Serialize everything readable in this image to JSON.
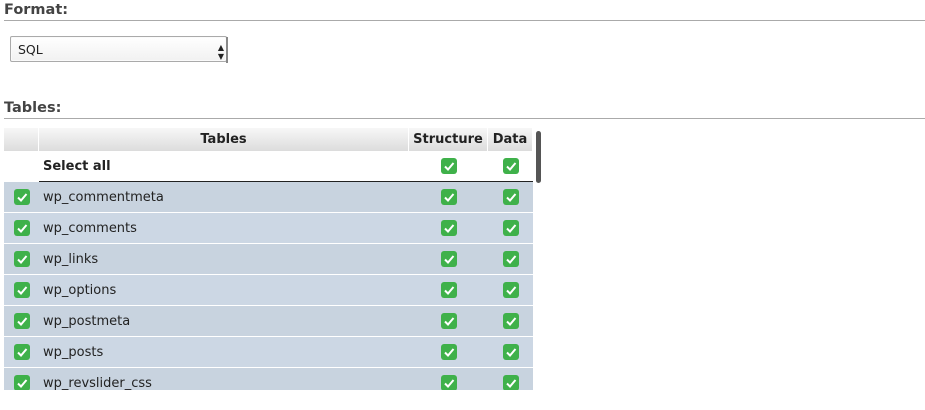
{
  "format": {
    "heading": "Format:",
    "selected": "SQL"
  },
  "tables": {
    "heading": "Tables:",
    "columns": {
      "tables": "Tables",
      "structure": "Structure",
      "data": "Data"
    },
    "select_all_label": "Select all",
    "rows": [
      {
        "name": "wp_commentmeta",
        "checked": true,
        "structure": true,
        "data": true
      },
      {
        "name": "wp_comments",
        "checked": true,
        "structure": true,
        "data": true
      },
      {
        "name": "wp_links",
        "checked": true,
        "structure": true,
        "data": true
      },
      {
        "name": "wp_options",
        "checked": true,
        "structure": true,
        "data": true
      },
      {
        "name": "wp_postmeta",
        "checked": true,
        "structure": true,
        "data": true
      },
      {
        "name": "wp_posts",
        "checked": true,
        "structure": true,
        "data": true
      },
      {
        "name": "wp_revslider_css",
        "checked": true,
        "structure": true,
        "data": true
      }
    ]
  },
  "icons": {
    "checkbox": "checkmark-icon",
    "select_arrow": "dropdown-arrow-icon"
  },
  "colors": {
    "checkbox_green": "#3fb14a",
    "row_bg": "#ccd7e4"
  }
}
